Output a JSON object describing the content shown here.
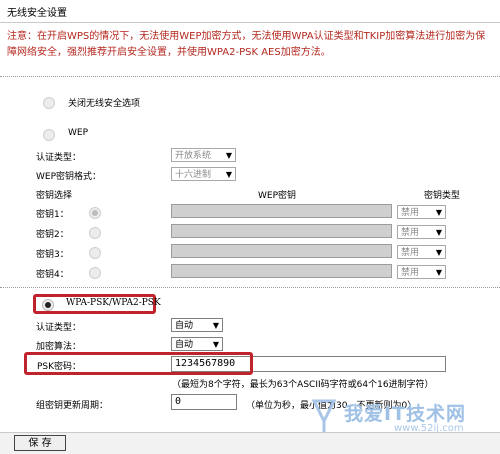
{
  "page": {
    "title": "无线安全设置"
  },
  "note": "注意：在开启WPS的情况下，无法使用WEP加密方式，无法使用WPA认证类型和TKIP加密算法进行加密为保障网络安全，强烈推荐开启安全设置，并使用WPA2-PSK AES加密方法。",
  "off_option": {
    "label": "关闭无线安全选项",
    "selected": false
  },
  "wep": {
    "label": "WEP",
    "selected": false,
    "auth_type_label": "认证类型：",
    "auth_type_value": "开放系统",
    "key_format_label": "WEP密钥格式：",
    "key_format_value": "十六进制",
    "col_key_select": "密钥选择",
    "col_wep_key": "WEP密钥",
    "col_key_type": "密钥类型",
    "keys": [
      {
        "label": "密钥1：",
        "selected": true,
        "value": "",
        "type": "禁用"
      },
      {
        "label": "密钥2：",
        "selected": false,
        "value": "",
        "type": "禁用"
      },
      {
        "label": "密钥3：",
        "selected": false,
        "value": "",
        "type": "禁用"
      },
      {
        "label": "密钥4：",
        "selected": false,
        "value": "",
        "type": "禁用"
      }
    ]
  },
  "wpa_psk": {
    "label": "WPA-PSK/WPA2-PSK",
    "selected": true,
    "auth_type_label": "认证类型：",
    "auth_type_value": "自动",
    "encryption_label": "加密算法：",
    "encryption_value": "自动",
    "psk_label": "PSK密码：",
    "psk_value": "1234567890",
    "psk_hint": "（最短为8个字符，最长为63个ASCII码字符或64个16进制字符）",
    "rekey_label": "组密钥更新周期：",
    "rekey_value": "0",
    "rekey_hint": "（单位为秒，最小值为30，不更新则为0）"
  },
  "save_button": "保 存",
  "watermark": {
    "text": "我爱IT技术网",
    "sub": "www.52ij.com"
  },
  "colors": {
    "note": "#b5281f",
    "highlight": "#c0232b",
    "watermark": "#9fc1e6"
  }
}
